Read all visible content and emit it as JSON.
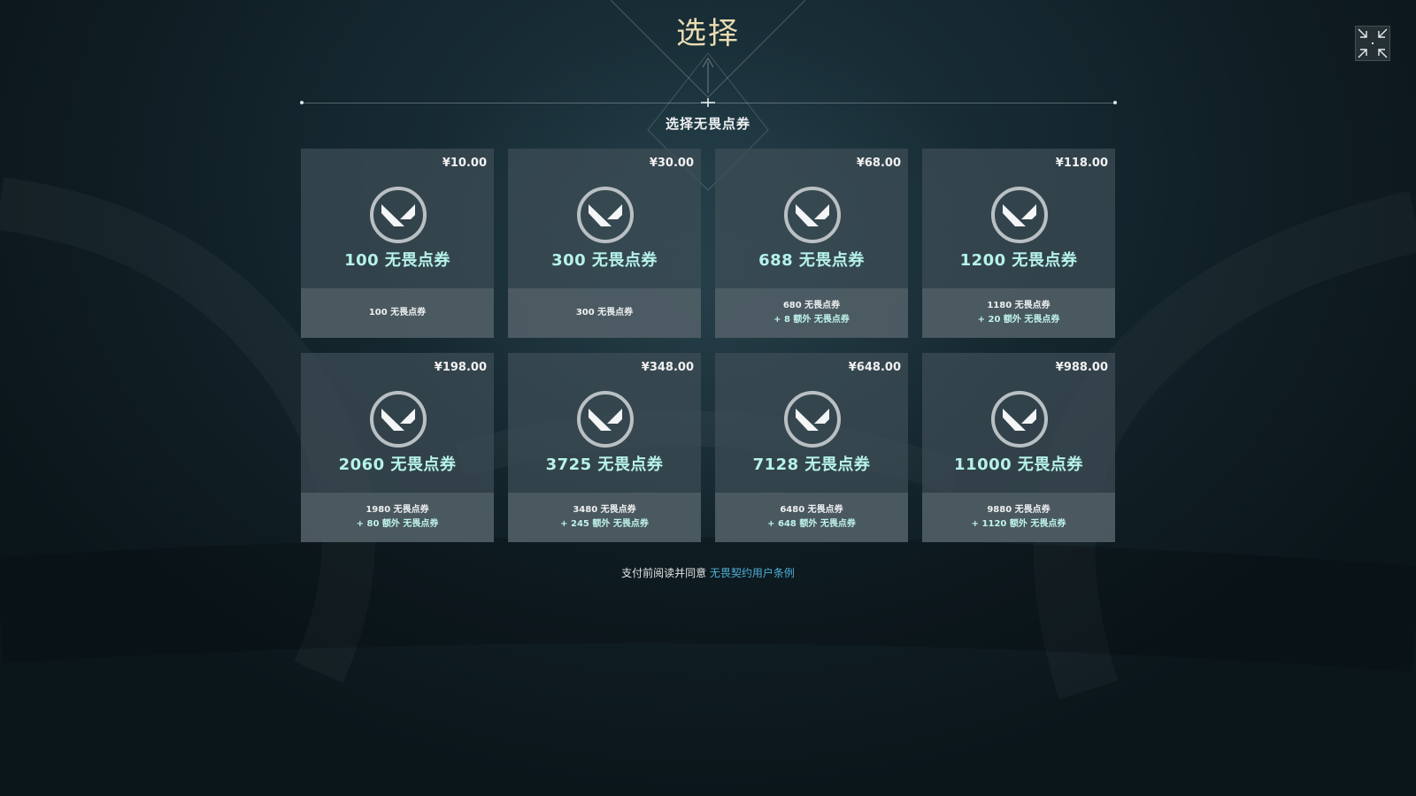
{
  "page": {
    "title": "选择",
    "subtitle": "选择无畏点券"
  },
  "offers": [
    {
      "price": "¥10.00",
      "amount": "100 无畏点券",
      "base": "100 无畏点券",
      "bonus": ""
    },
    {
      "price": "¥30.00",
      "amount": "300 无畏点券",
      "base": "300 无畏点券",
      "bonus": ""
    },
    {
      "price": "¥68.00",
      "amount": "688 无畏点券",
      "base": "680 无畏点券",
      "bonus": "+ 8 额外 无畏点券"
    },
    {
      "price": "¥118.00",
      "amount": "1200 无畏点券",
      "base": "1180 无畏点券",
      "bonus": "+ 20 额外 无畏点券"
    },
    {
      "price": "¥198.00",
      "amount": "2060 无畏点券",
      "base": "1980 无畏点券",
      "bonus": "+ 80 额外 无畏点券"
    },
    {
      "price": "¥348.00",
      "amount": "3725 无畏点券",
      "base": "3480 无畏点券",
      "bonus": "+ 245 额外 无畏点券"
    },
    {
      "price": "¥648.00",
      "amount": "7128 无畏点券",
      "base": "6480 无畏点券",
      "bonus": "+ 648 额外 无畏点券"
    },
    {
      "price": "¥988.00",
      "amount": "11000 无畏点券",
      "base": "9880 无畏点券",
      "bonus": "+ 1120 额外 无畏点券"
    }
  ],
  "footer": {
    "terms_prefix": "支付前阅读并同意",
    "terms_link": "无畏契约用户条例"
  },
  "icons": {
    "close": "collapse-fullscreen-icon",
    "logo": "valorant-logo-icon"
  },
  "colors": {
    "title": "#eadcb2",
    "amount": "#b6f2ea",
    "link": "#4fb0d8"
  }
}
